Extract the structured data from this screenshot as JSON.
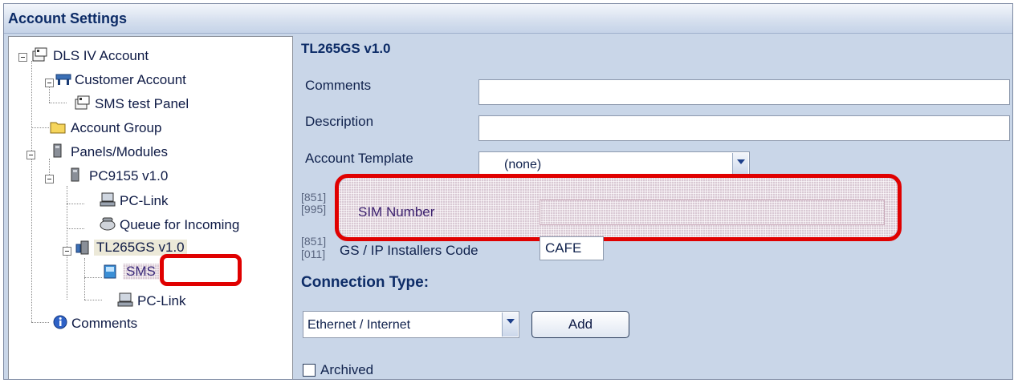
{
  "window": {
    "title": "Account Settings"
  },
  "tree": {
    "root": "DLS IV Account",
    "customer_account": "Customer Account",
    "sms_test_panel": "SMS test Panel",
    "account_group": "Account Group",
    "panels_modules": "Panels/Modules",
    "pc9155": "PC9155 v1.0",
    "pc_link_1": "PC-Link",
    "queue_incoming": "Queue for Incoming",
    "tl265gs": "TL265GS v1.0",
    "sms": "SMS",
    "pc_link_2": "PC-Link",
    "comments": "Comments"
  },
  "panel": {
    "title": "TL265GS v1.0",
    "comments_label": "Comments",
    "comments_value": "",
    "description_label": "Description",
    "description_value": "",
    "template_label": "Account Template",
    "template_value": "(none)",
    "code_851_a": "[851]",
    "code_995": "[995]",
    "sim_label": "SIM Number",
    "sim_value": "",
    "code_851_b": "[851]",
    "code_011": "[011]",
    "installer_label": "GS / IP Installers Code",
    "installer_value": "CAFE",
    "connection_type_label": "Connection Type:",
    "connection_value": "Ethernet / Internet",
    "add_button": "Add",
    "archived_label": "Archived",
    "archived_checked": false
  },
  "colors": {
    "highlight": "#e00000",
    "title_text": "#0d2c67",
    "panel_bg": "#c9d6e8"
  }
}
